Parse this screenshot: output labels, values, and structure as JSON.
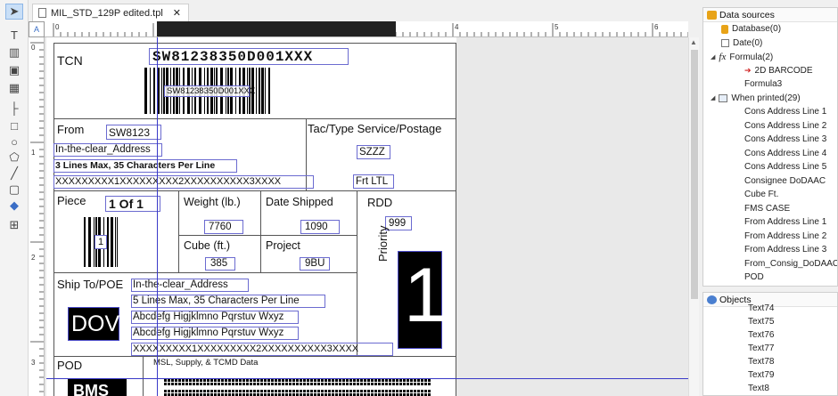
{
  "tab": {
    "title": "MIL_STD_129P edited.tpl",
    "close": "✕"
  },
  "ruler": {
    "top_numbers": [
      "0",
      "1",
      "2",
      "3",
      "4",
      "5",
      "6"
    ],
    "left_numbers": [
      "0",
      "1",
      "2",
      "3"
    ],
    "corner": "A"
  },
  "toolbar": {
    "tools": [
      {
        "name": "pointer-tool-icon",
        "glyph": "➤"
      },
      {
        "name": "text-tool-icon",
        "glyph": "T"
      },
      {
        "name": "barcode-tool-icon",
        "glyph": "▥"
      },
      {
        "name": "image-tool-icon",
        "glyph": "▣"
      },
      {
        "name": "table-tool-icon",
        "glyph": "▦"
      },
      {
        "name": "line-tool-icon",
        "glyph": "├"
      },
      {
        "name": "rectangle-tool-icon",
        "glyph": "□"
      },
      {
        "name": "ellipse-tool-icon",
        "glyph": "○"
      },
      {
        "name": "polygon-tool-icon",
        "glyph": "⬠"
      },
      {
        "name": "diagonal-line-tool-icon",
        "glyph": "╱"
      },
      {
        "name": "rounded-rect-tool-icon",
        "glyph": "▢"
      },
      {
        "name": "fill-tool-icon",
        "glyph": "◆"
      },
      {
        "name": "grid-tool-icon",
        "glyph": "⊞"
      }
    ]
  },
  "label": {
    "tcn_label": "TCN",
    "tcn_value": "SW81238350D001XXX",
    "barcode_text": "SW81238350D001XXX",
    "from_label": "From",
    "from_value": "SW8123",
    "from_address": "In-the-clear_Address",
    "from_lines_hint": "3 Lines Max, 35 Characters Per Line",
    "from_x_line": "XXXXXXXXX1XXXXXXXXX2XXXXXXXXXX3XXXX",
    "tac_header": "Tac/Type Service/Postage",
    "tac_value": "SZZZ",
    "tac_service": "Frt LTL",
    "piece_label": "Piece",
    "piece_value": "1 Of 1",
    "piece_barcode_text": "1",
    "weight_label": "Weight (lb.)",
    "weight_value": "7760",
    "date_shipped_label": "Date Shipped",
    "date_shipped_value": "1090",
    "rdd_label": "RDD",
    "rdd_value": "999",
    "cube_label": "Cube (ft.)",
    "cube_value": "385",
    "project_label": "Project",
    "project_value": "9BU",
    "priority_label": "Priority",
    "priority_value": "1",
    "ship_to_label": "Ship To/POE",
    "ship_to_address": "In-the-clear_Address",
    "ship_to_hint": "5 Lines Max, 35 Characters Per Line",
    "ship_to_line1": "Abcdefg Higjklmno Pqrstuv Wxyz",
    "ship_to_line2": "Abcdefg Higjklmno Pqrstuv Wxyz",
    "ship_to_x_line": "XXXXXXXXX1XXXXXXXXX2XXXXXXXXXX3XXXX",
    "dov_value": "DOV",
    "pod_label": "POD",
    "msl_text": "MSL, Supply, & TCMD Data",
    "bottom_box_value": "BMS"
  },
  "data_sources": {
    "title": "Data sources",
    "items": [
      {
        "label": "Database(0)",
        "icon": "database-icon",
        "level": 1,
        "expander": ""
      },
      {
        "label": "Date(0)",
        "icon": "date-icon",
        "level": 1,
        "expander": ""
      },
      {
        "label": "Formula(2)",
        "icon": "formula-icon",
        "level": 0,
        "expander": "◢"
      },
      {
        "label": "2D BARCODE",
        "icon": "arrow-icon",
        "level": 2,
        "expander": ""
      },
      {
        "label": "Formula3",
        "icon": "",
        "level": 2,
        "expander": ""
      },
      {
        "label": "When printed(29)",
        "icon": "table-icon",
        "level": 0,
        "expander": "◢"
      },
      {
        "label": "Cons Address Line 1",
        "icon": "",
        "level": 2,
        "expander": ""
      },
      {
        "label": "Cons Address Line 2",
        "icon": "",
        "level": 2,
        "expander": ""
      },
      {
        "label": "Cons Address Line 3",
        "icon": "",
        "level": 2,
        "expander": ""
      },
      {
        "label": "Cons Address Line 4",
        "icon": "",
        "level": 2,
        "expander": ""
      },
      {
        "label": "Cons Address Line 5",
        "icon": "",
        "level": 2,
        "expander": ""
      },
      {
        "label": "Consignee DoDAAC",
        "icon": "",
        "level": 2,
        "expander": ""
      },
      {
        "label": "Cube Ft.",
        "icon": "",
        "level": 2,
        "expander": ""
      },
      {
        "label": "FMS CASE",
        "icon": "",
        "level": 2,
        "expander": ""
      },
      {
        "label": "From Address Line 1",
        "icon": "",
        "level": 2,
        "expander": ""
      },
      {
        "label": "From Address Line 2",
        "icon": "",
        "level": 2,
        "expander": ""
      },
      {
        "label": "From Address Line 3",
        "icon": "",
        "level": 2,
        "expander": ""
      },
      {
        "label": "From_Consig_DoDAAC",
        "icon": "",
        "level": 2,
        "expander": ""
      },
      {
        "label": "POD",
        "icon": "",
        "level": 2,
        "expander": ""
      }
    ]
  },
  "objects": {
    "title": "Objects",
    "items": [
      "Text74",
      "Text75",
      "Text76",
      "Text77",
      "Text78",
      "Text79",
      "Text8"
    ]
  },
  "colors": {
    "field_border": "#6b6bd0",
    "selection": "#3a3ac8",
    "accent": "#e8a317"
  }
}
